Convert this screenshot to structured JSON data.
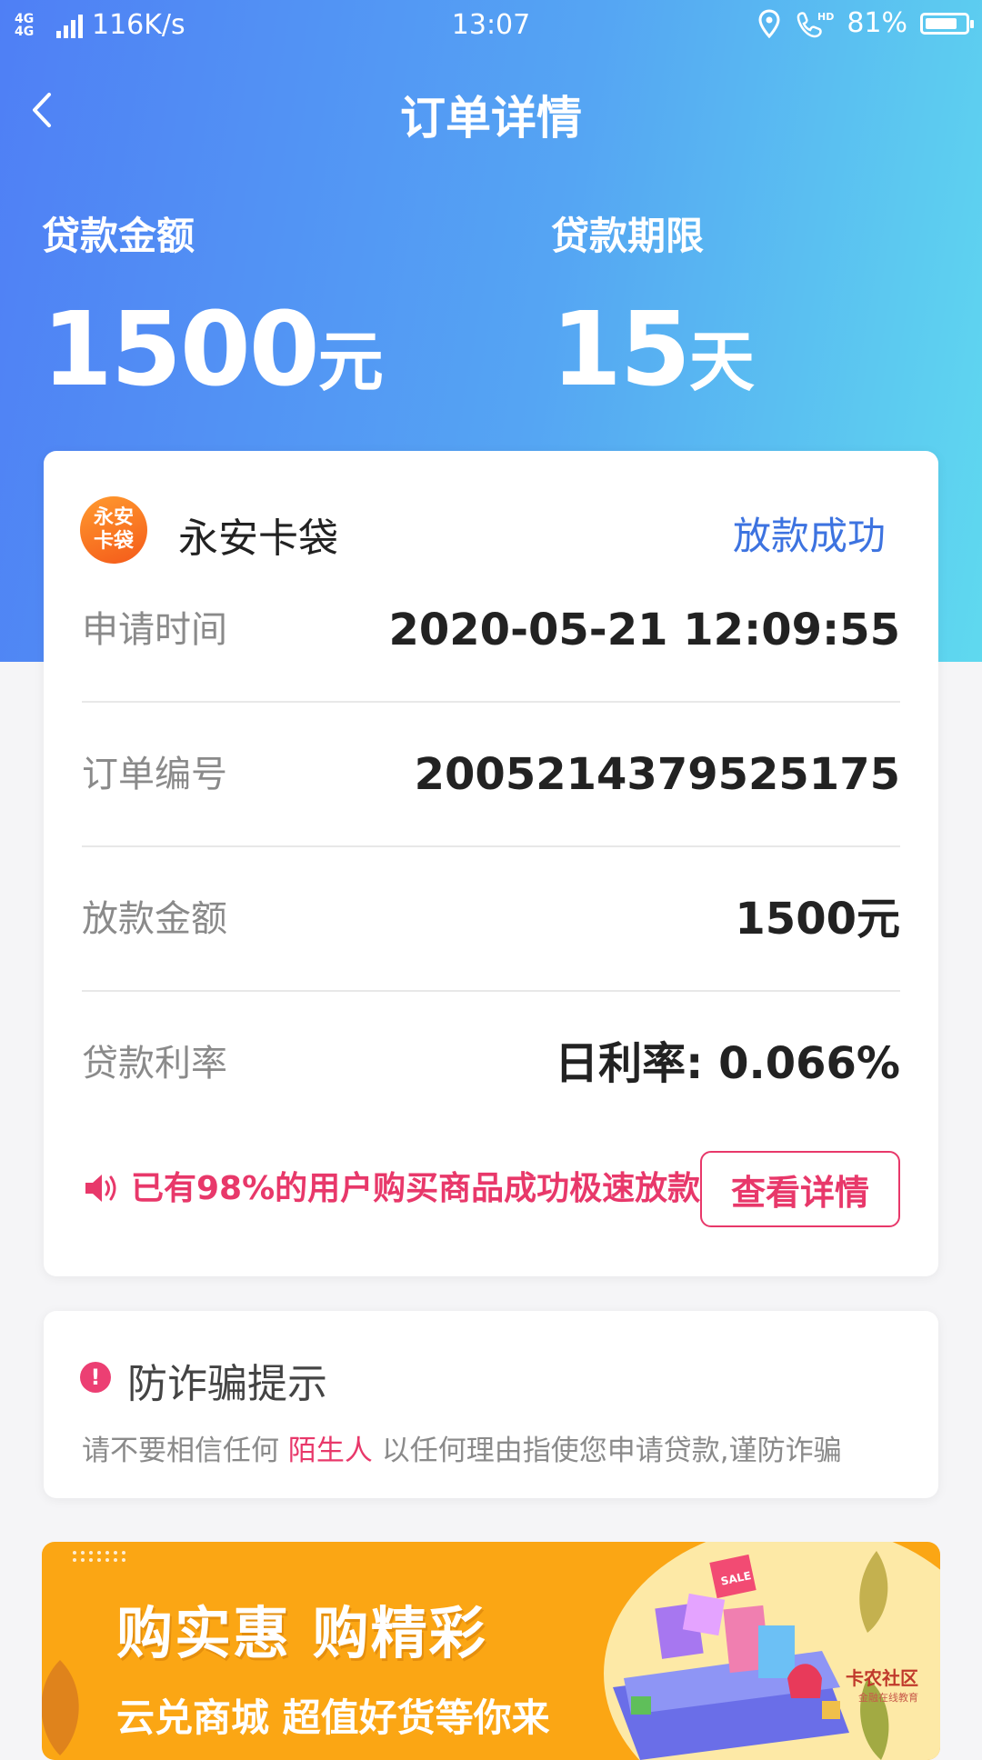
{
  "status_bar": {
    "network": "4G 4G",
    "speed": "116K/s",
    "time": "13:07",
    "battery": "81%",
    "battery_level": 0.81,
    "icons": [
      "location-icon",
      "hd-call-icon",
      "battery-icon"
    ]
  },
  "header": {
    "title": "订单详情",
    "back_icon": "chevron-left-icon"
  },
  "summary": {
    "amount_label": "贷款金额",
    "amount_value": "1500",
    "amount_unit": "元",
    "term_label": "贷款期限",
    "term_value": "15",
    "term_unit": "天"
  },
  "order": {
    "lender_logo_text": "永安卡袋",
    "lender_name": "永安卡袋",
    "status": "放款成功",
    "rows": [
      {
        "label": "申请时间",
        "value": "2020-05-21 12:09:55"
      },
      {
        "label": "订单编号",
        "value": "2005214379525175"
      },
      {
        "label": "放款金额",
        "value": "1500元"
      },
      {
        "label": "贷款利率",
        "value": "日利率: 0.066%"
      }
    ],
    "promo_text": "已有98%的用户购买商品成功极速放款",
    "promo_button": "查看详情"
  },
  "fraud": {
    "title": "防诈骗提示",
    "text_before": "请不要相信任何 ",
    "text_highlight": "陌生人",
    "text_after": " 以任何理由指使您申请贷款,谨防诈骗"
  },
  "banner": {
    "title": "购实惠 购精彩",
    "subtitle": "云兑商城 超值好货等你来",
    "art_tag": "SALE",
    "watermark": "卡农社区",
    "watermark_sub": "金融在线教育"
  },
  "colors": {
    "accent_blue": "#3d73e0",
    "accent_pink": "#e8386a",
    "banner_orange": "#fba614"
  }
}
